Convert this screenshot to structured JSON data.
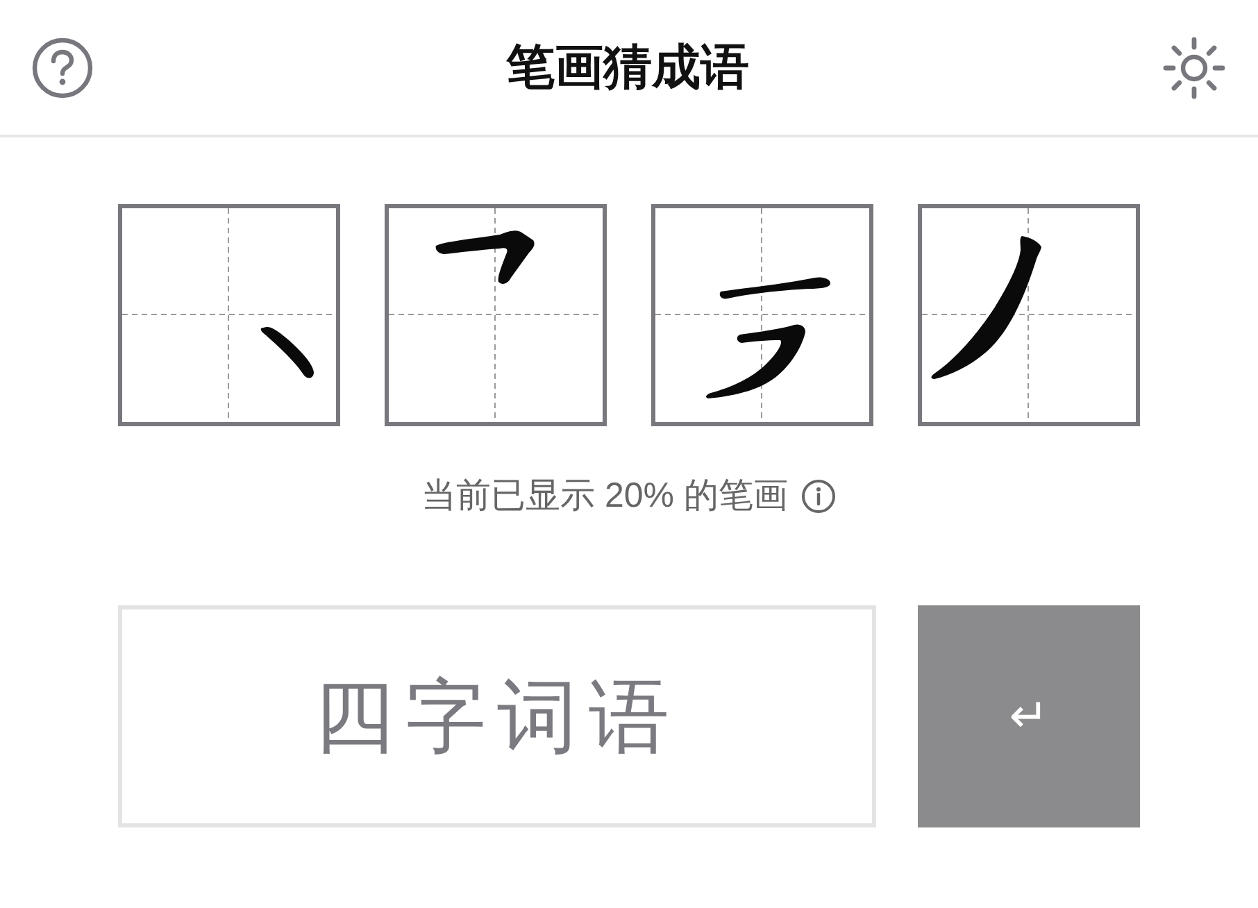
{
  "header": {
    "title": "笔画猜成语"
  },
  "tiles": [
    {
      "kind": "dot"
    },
    {
      "kind": "turn"
    },
    {
      "kind": "zigzag"
    },
    {
      "kind": "sweep"
    }
  ],
  "progress": {
    "text": "当前已显示 20% 的笔画"
  },
  "answer": {
    "placeholder": "四字词语"
  },
  "submit": {
    "label": "↵"
  }
}
